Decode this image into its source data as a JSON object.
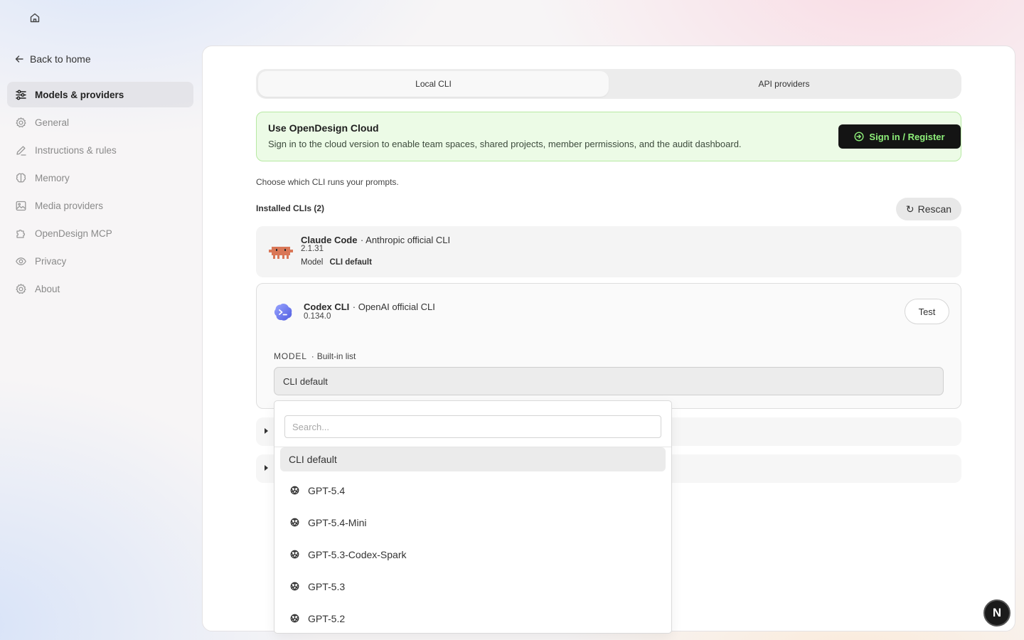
{
  "nav": {
    "back_label": "Back to home",
    "items": [
      {
        "label": "Models & providers",
        "icon": "sliders-icon",
        "active": true
      },
      {
        "label": "General",
        "icon": "gear-icon"
      },
      {
        "label": "Instructions & rules",
        "icon": "pencil-icon"
      },
      {
        "label": "Memory",
        "icon": "brain-icon"
      },
      {
        "label": "Media providers",
        "icon": "image-icon"
      },
      {
        "label": "OpenDesign MCP",
        "icon": "puzzle-icon"
      },
      {
        "label": "Privacy",
        "icon": "eye-icon"
      },
      {
        "label": "About",
        "icon": "gear-icon"
      }
    ]
  },
  "tabs": [
    {
      "label": "Local CLI",
      "active": true
    },
    {
      "label": "API providers",
      "active": false
    }
  ],
  "cloud": {
    "title": "Use OpenDesign Cloud",
    "description": "Sign in to the cloud version to enable team spaces, shared projects, member permissions, and the audit dashboard.",
    "button_label": "Sign in / Register",
    "accent": "#8ef07a"
  },
  "main": {
    "choose_text": "Choose which CLI runs your prompts.",
    "installed_label": "Installed CLIs (2)",
    "rescan_label": "Rescan"
  },
  "clis": [
    {
      "name": "Claude Code",
      "description": "Anthropic official CLI",
      "version": "2.1.31",
      "model_label": "Model",
      "model_value": "CLI default",
      "logo_color": "#d97757"
    },
    {
      "name": "Codex CLI",
      "description": "OpenAI official CLI",
      "version": "0.134.0",
      "test_label": "Test",
      "model_heading": "MODEL",
      "model_hint": "Built-in list",
      "model_value": "CLI default",
      "logo_color": "#6f7cf2"
    }
  ],
  "dropdown": {
    "search_placeholder": "Search...",
    "options": [
      {
        "label": "CLI default",
        "selected": true
      },
      {
        "label": "GPT-5.4",
        "icon": "openai-icon"
      },
      {
        "label": "GPT-5.4-Mini",
        "icon": "openai-icon"
      },
      {
        "label": "GPT-5.3-Codex-Spark",
        "icon": "openai-icon"
      },
      {
        "label": "GPT-5.3",
        "icon": "openai-icon"
      },
      {
        "label": "GPT-5.2",
        "icon": "openai-icon"
      }
    ]
  },
  "badge": {
    "label": "N"
  }
}
